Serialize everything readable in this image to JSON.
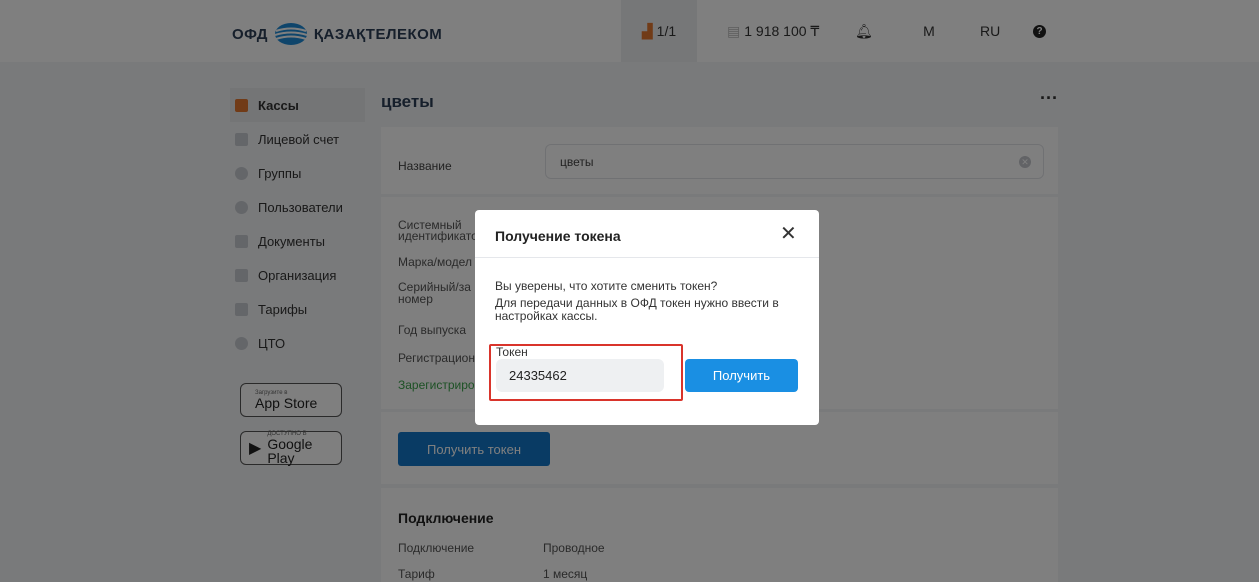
{
  "header": {
    "logo_prefix": "ОФД",
    "logo_brand": "ҚАЗАҚТЕЛЕКОМ",
    "kassa_counter": "1/1",
    "balance": "1 918 100 ₸",
    "avatar_letter": "M",
    "language": "RU"
  },
  "sidebar": {
    "items": [
      {
        "label": "Кассы",
        "icon": "cash-register-icon"
      },
      {
        "label": "Лицевой счет",
        "icon": "wallet-icon"
      },
      {
        "label": "Группы",
        "icon": "groups-icon"
      },
      {
        "label": "Пользователи",
        "icon": "users-icon"
      },
      {
        "label": "Документы",
        "icon": "documents-icon"
      },
      {
        "label": "Организация",
        "icon": "organization-icon"
      },
      {
        "label": "Тарифы",
        "icon": "tariffs-icon"
      },
      {
        "label": "ЦТО",
        "icon": "service-center-icon"
      }
    ],
    "appstore_small": "Загрузите в",
    "appstore_big": "App Store",
    "googleplay_small": "ДОСТУПНО В",
    "googleplay_big": "Google Play"
  },
  "main": {
    "title": "цветы",
    "name_label": "Название",
    "name_value": "цветы",
    "info_rows": [
      "Системный",
      "идентификато",
      "Марка/модел",
      "Серийный/за",
      "номер",
      "Год выпуска",
      "Регистрацион",
      "Зарегистриро"
    ],
    "get_token_button": "Получить токен",
    "connection_title": "Подключение",
    "connection_rows": [
      {
        "label": "Подключение",
        "value": "Проводное"
      },
      {
        "label": "Тариф",
        "value": "1 месяц"
      }
    ]
  },
  "modal": {
    "title": "Получение токена",
    "close_symbol": "✕",
    "question": "Вы уверены, что хотите сменить токен?",
    "note": "Для передачи данных в ОФД токен нужно ввести в настройках кассы.",
    "token_label": "Токен",
    "token_value": "24335462",
    "submit_button": "Получить"
  },
  "colors": {
    "primary_button": "#1a8fe3",
    "highlight_border": "#d9342b",
    "active_icon": "#e3762f",
    "registered_text": "#3aa34a"
  }
}
